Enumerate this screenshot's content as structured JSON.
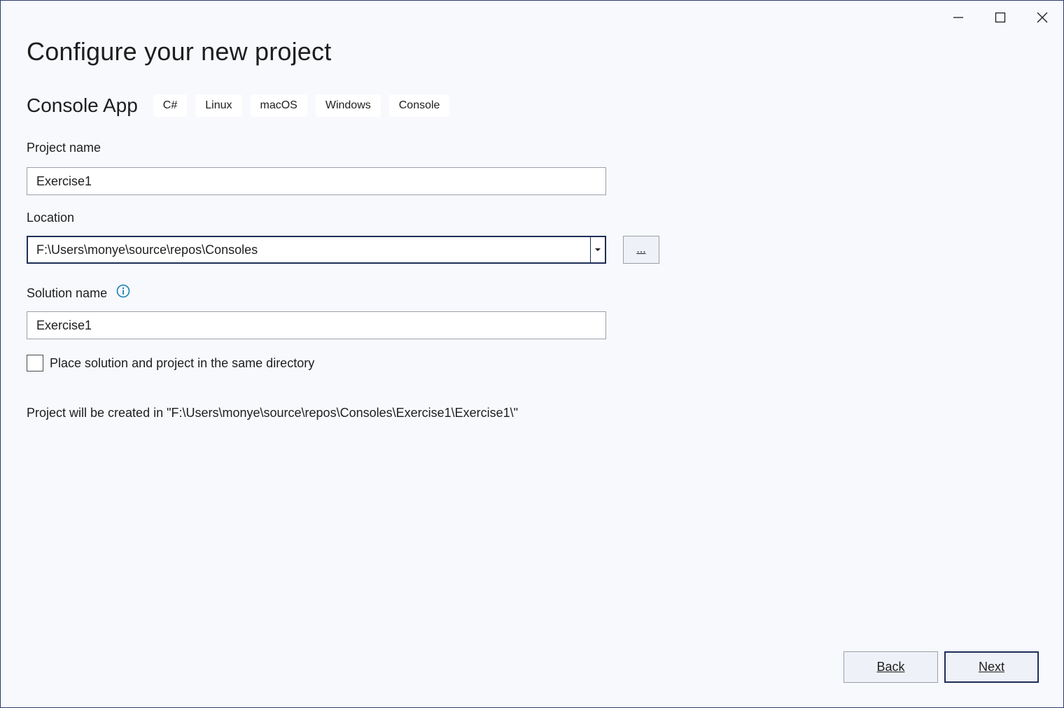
{
  "window": {
    "controls": [
      {
        "name": "minimize-icon"
      },
      {
        "name": "maximize-icon"
      },
      {
        "name": "close-icon"
      }
    ]
  },
  "header": {
    "title": "Configure your new project"
  },
  "template": {
    "name": "Console App",
    "tags": [
      "C#",
      "Linux",
      "macOS",
      "Windows",
      "Console"
    ]
  },
  "form": {
    "project_name": {
      "label": "Project name",
      "value": "Exercise1"
    },
    "location": {
      "label": "Location",
      "value": "F:\\Users\\monye\\source\\repos\\Consoles",
      "browse_label": "..."
    },
    "solution_name": {
      "label": "Solution name",
      "value": "Exercise1",
      "info_icon": "info-icon"
    },
    "same_directory": {
      "label": "Place solution and project in the same directory",
      "checked": false
    },
    "created_in": "Project will be created in \"F:\\Users\\monye\\source\\repos\\Consoles\\Exercise1\\Exercise1\\\""
  },
  "footer": {
    "back_label": "Back",
    "next_label": "Next"
  },
  "colors": {
    "background": "#f7f9fd",
    "accent_border": "#1e2e58",
    "info_icon": "#1a7fb5"
  }
}
